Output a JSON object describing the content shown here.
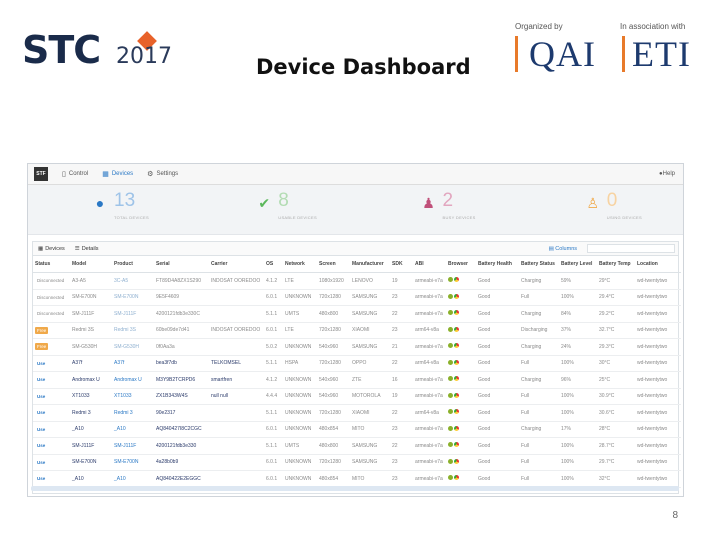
{
  "header": {
    "logo_text": "STC",
    "logo_year": "2017",
    "title": "Device Dashboard",
    "organized_by_caption": "Organized by",
    "organizer": "QAI",
    "association_caption": "In association with",
    "associate": "ETI",
    "page_number": "8"
  },
  "app": {
    "nav": {
      "logo": "STF",
      "items": [
        {
          "icon": "control-icon",
          "label": "Control"
        },
        {
          "icon": "devices-icon",
          "label": "Devices"
        },
        {
          "icon": "settings-icon",
          "label": "Settings"
        }
      ],
      "help": "Help"
    },
    "stats": [
      {
        "icon": "globe-icon",
        "value": "13",
        "label": "TOTAL DEVICES",
        "color": "#2a78c5"
      },
      {
        "icon": "check-icon",
        "value": "8",
        "label": "USABLE DEVICES",
        "color": "#5cb85c"
      },
      {
        "icon": "users-icon",
        "value": "2",
        "label": "BUSY DEVICES",
        "color": "#c0507a"
      },
      {
        "icon": "user-icon",
        "value": "0",
        "label": "USING DEVICES",
        "color": "#f0a94a"
      }
    ],
    "tabs": [
      {
        "icon": "grid-icon",
        "label": "Devices"
      },
      {
        "icon": "list-icon",
        "label": "Details"
      }
    ],
    "columns_button": "Columns",
    "table": {
      "headers": [
        "Status",
        "Model",
        "Product",
        "Serial",
        "Carrier",
        "OS",
        "Network",
        "Screen",
        "Manufacturer",
        "SDK",
        "ABI",
        "Browser",
        "Battery Health",
        "Battery Status",
        "Battery Level",
        "Battery Temp",
        "Location"
      ],
      "rows": [
        [
          "Disconnected",
          "A3-A5",
          "3C-A5",
          "FT89D4A8ZX1S290",
          "INDOSAT OOREDOO",
          "4.1.2",
          "LTE",
          "1080x1920",
          "LENOVO",
          "19",
          "armeabi-v7a",
          "",
          "Good",
          "Charging",
          "59%",
          "29°C",
          "wd-twentytwo"
        ],
        [
          "Disconnected",
          "SM-E700N",
          "SM-E700N",
          "9E5F4609",
          "",
          "6.0.1",
          "UNKNOWN",
          "720x1280",
          "SAMSUNG",
          "23",
          "armeabi-v7a",
          "",
          "Good",
          "Full",
          "100%",
          "29.4°C",
          "wd-twentytwo"
        ],
        [
          "Disconnected",
          "SM-J111F",
          "SM-J111F",
          "4200121fdb3e330C",
          "",
          "5.1.1",
          "UMTS",
          "480x800",
          "SAMSUNG",
          "22",
          "armeabi-v7a",
          "",
          "Good",
          "Charging",
          "84%",
          "29.2°C",
          "wd-twentytwo"
        ],
        [
          "Free",
          "Redmi 3S",
          "Redmi 3S",
          "60be09de7d41",
          "INDOSAT OOREDOO",
          "6.0.1",
          "LTE",
          "720x1280",
          "XIAOMI",
          "23",
          "arm64-v8a",
          "",
          "Good",
          "Discharging",
          "37%",
          "32.7°C",
          "wd-twentytwo"
        ],
        [
          "Free",
          "SM-G530H",
          "SM-G530H",
          "0f0Aa3a",
          "",
          "5.0.2",
          "UNKNOWN",
          "540x960",
          "SAMSUNG",
          "21",
          "armeabi-v7a",
          "",
          "Good",
          "Charging",
          "24%",
          "29.3°C",
          "wd-twentytwo"
        ],
        [
          "Use",
          "A37f",
          "A37f",
          "bea3f7db",
          "TELKOMSEL",
          "5.1.1",
          "HSPA",
          "720x1280",
          "OPPO",
          "22",
          "arm64-v8a",
          "",
          "Good",
          "Full",
          "100%",
          "30°C",
          "wd-twentytwo"
        ],
        [
          "Use",
          "Andromax U",
          "Andromax U",
          "M3Y9B2TCRPD6",
          "smartfren",
          "4.1.2",
          "UNKNOWN",
          "540x960",
          "ZTE",
          "16",
          "armeabi-v7a",
          "",
          "Good",
          "Charging",
          "96%",
          "25°C",
          "wd-twentytwo"
        ],
        [
          "Use",
          "XT1033",
          "XT1033",
          "ZX1B343W4S",
          "null null",
          "4.4.4",
          "UNKNOWN",
          "540x960",
          "MOTOROLA",
          "19",
          "armeabi-v7a",
          "",
          "Good",
          "Full",
          "100%",
          "30.9°C",
          "wd-twentytwo"
        ],
        [
          "Use",
          "Redmi 3",
          "Redmi 3",
          "90e2317",
          "",
          "5.1.1",
          "UNKNOWN",
          "720x1280",
          "XIAOMI",
          "22",
          "arm64-v8a",
          "",
          "Good",
          "Full",
          "100%",
          "30.6°C",
          "wd-twentytwo"
        ],
        [
          "Use",
          "_A10",
          "_A10",
          "AQ840427I8C2CGC",
          "",
          "6.0.1",
          "UNKNOWN",
          "480x854",
          "MITO",
          "23",
          "armeabi-v7a",
          "",
          "Good",
          "Charging",
          "17%",
          "28°C",
          "wd-twentytwo"
        ],
        [
          "Use",
          "SM-J111F",
          "SM-J111F",
          "4200121fdb3e330",
          "",
          "5.1.1",
          "UMTS",
          "480x800",
          "SAMSUNG",
          "22",
          "armeabi-v7a",
          "",
          "Good",
          "Full",
          "100%",
          "28.7°C",
          "wd-twentytwo"
        ],
        [
          "Use",
          "SM-E700N",
          "SM-E700N",
          "4a28b0b9",
          "",
          "6.0.1",
          "UNKNOWN",
          "720x1280",
          "SAMSUNG",
          "23",
          "armeabi-v7a",
          "",
          "Good",
          "Full",
          "100%",
          "29.7°C",
          "wd-twentytwo"
        ],
        [
          "Use",
          "_A10",
          "_A10",
          "AQ840422E2EGGC",
          "",
          "6.0.1",
          "UNKNOWN",
          "480x854",
          "MITO",
          "23",
          "armeabi-v7a",
          "",
          "Good",
          "Full",
          "100%",
          "32°C",
          "wd-twentytwo"
        ]
      ]
    }
  }
}
